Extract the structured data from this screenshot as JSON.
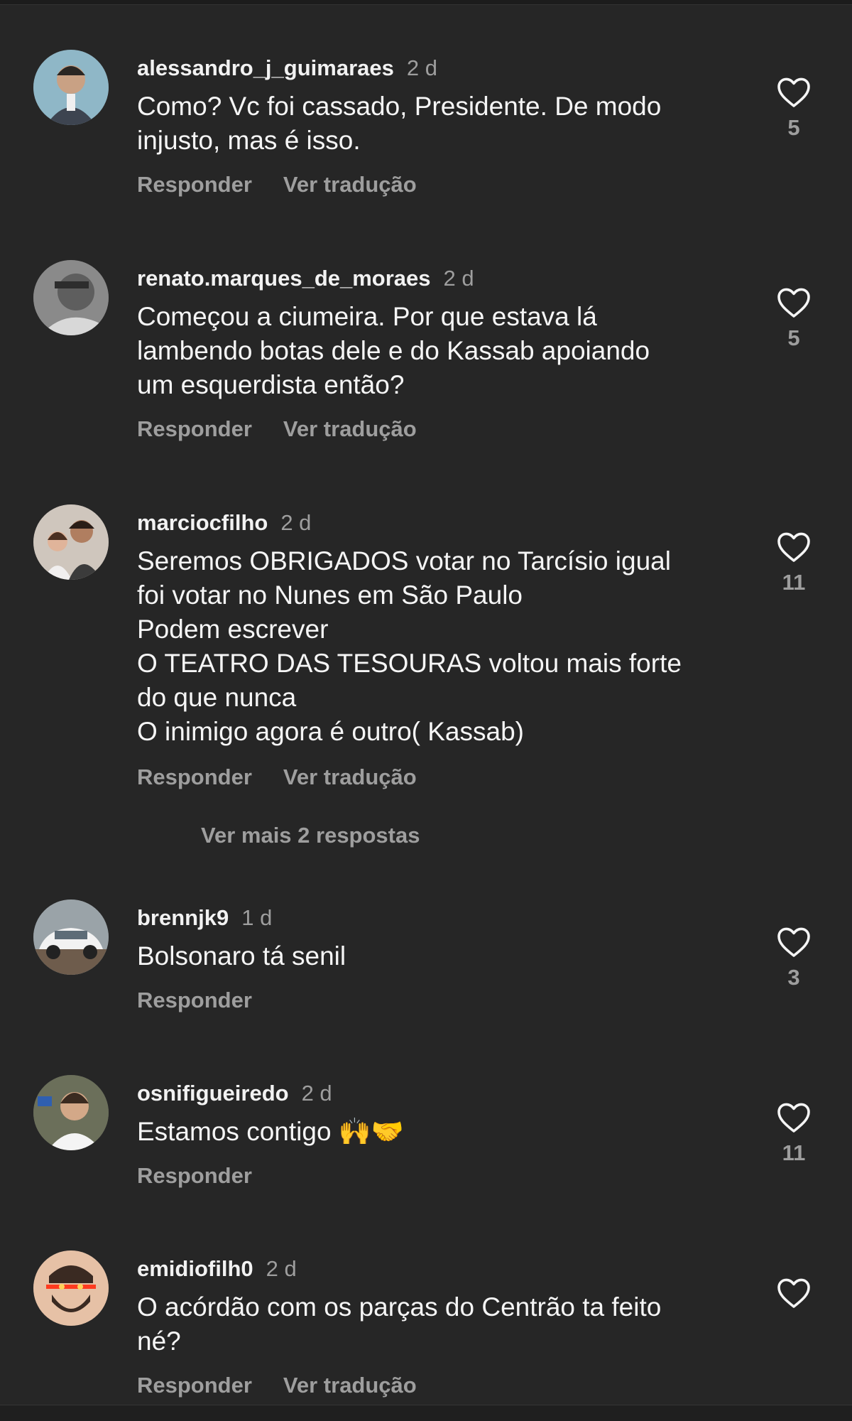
{
  "comments": [
    {
      "user": "alessandro_j_guimaraes",
      "time": "2 d",
      "text": "Como? Vc foi cassado, Presidente. De modo\ninjusto, mas é isso.",
      "likes": "5",
      "reply": "Responder",
      "translate": "Ver tradução"
    },
    {
      "user": "renato.marques_de_moraes",
      "time": "2 d",
      "text": "Começou a ciumeira. Por que estava lá\nlambendo botas dele e do Kassab apoiando\num esquerdista então?",
      "likes": "5",
      "reply": "Responder",
      "translate": "Ver tradução"
    },
    {
      "user": "marciocfilho",
      "time": "2 d",
      "text": "Seremos OBRIGADOS votar no Tarcísio igual\nfoi votar no Nunes em São Paulo\nPodem escrever\nO TEATRO DAS TESOURAS voltou mais forte\ndo que nunca\nO inimigo agora é outro( Kassab)",
      "likes": "11",
      "reply": "Responder",
      "translate": "Ver tradução"
    },
    {
      "user": "brennjk9",
      "time": "1 d",
      "text": "Bolsonaro tá senil",
      "likes": "3",
      "reply": "Responder"
    },
    {
      "user": "osnifigueiredo",
      "time": "2 d",
      "text": "Estamos contigo 🙌🤝",
      "likes": "11",
      "reply": "Responder"
    },
    {
      "user": "emidiofilh0",
      "time": "2 d",
      "text": "O acórdão com os parças do Centrão ta feito\nné?",
      "reply": "Responder",
      "translate": "Ver tradução"
    }
  ],
  "more_replies": "Ver mais 2 respostas",
  "icons": {
    "like": "heart-outline-icon"
  },
  "colors": {
    "background": "#262626",
    "text": "#f5f5f5",
    "muted": "#9e9e9e"
  }
}
